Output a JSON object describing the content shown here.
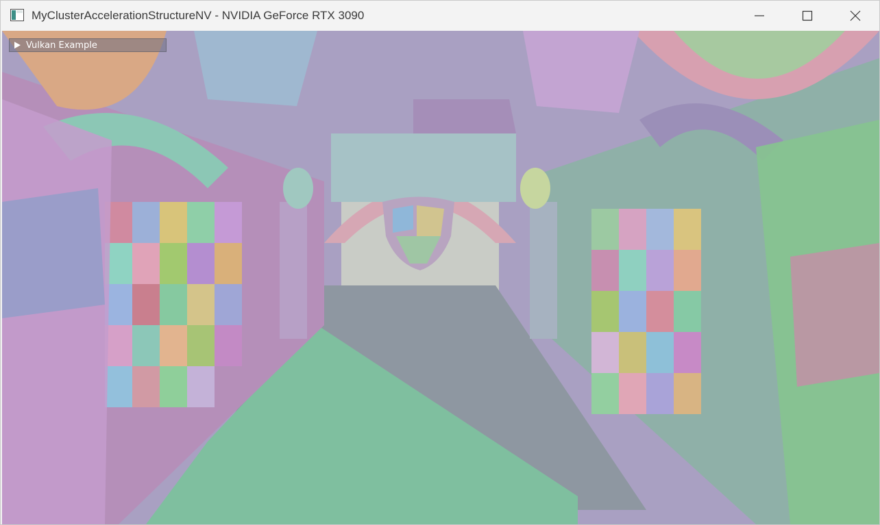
{
  "window": {
    "title": "MyClusterAccelerationStructureNV - NVIDIA GeForce RTX 3090",
    "controls": {
      "minimize_icon": "minimize-icon",
      "maximize_icon": "maximize-icon",
      "close_icon": "close-icon"
    }
  },
  "overlay": {
    "header_label": "Vulkan Example",
    "header_state": "collapsed",
    "arrow_icon": "triangle-right-icon"
  },
  "viewport": {
    "description_icon": "rendered-scene"
  },
  "colors": {
    "titlebar_bg": "#f3f3f3",
    "title_text": "#3a3a3a",
    "floor": "#7fbf9f",
    "overlay_bg": "#6e6e82"
  }
}
